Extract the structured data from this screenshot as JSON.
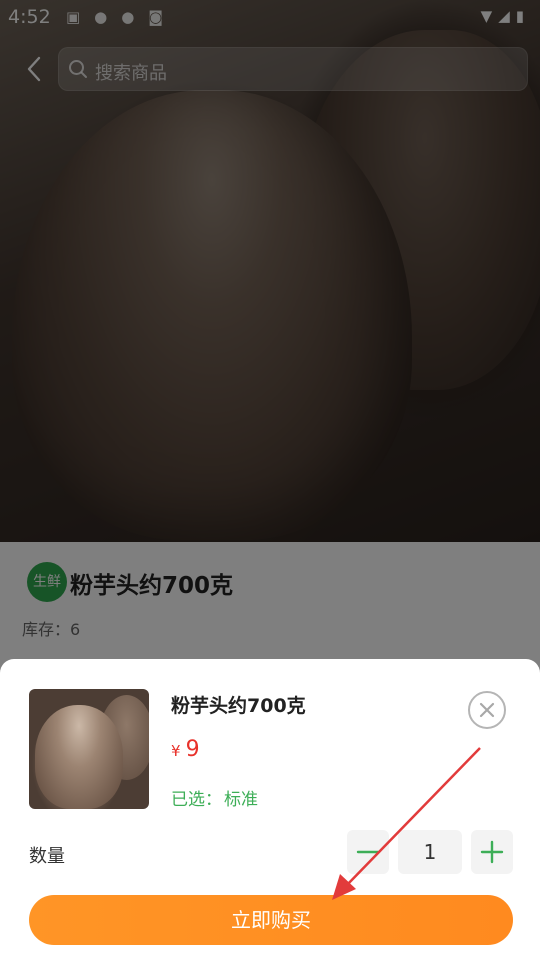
{
  "status_bar": {
    "time": "4:52"
  },
  "search": {
    "placeholder": "搜索商品"
  },
  "product_page": {
    "tag": "生鲜",
    "title": "粉芋头约700克",
    "stock_label": "库存：",
    "stock_value": "6"
  },
  "purchase_sheet": {
    "product_name": "粉芋头约700克",
    "currency_symbol": "¥",
    "price": "9",
    "selected_label": "已选：",
    "selected_value": "标准",
    "quantity_label": "数量",
    "quantity_value": "1",
    "buy_now_label": "立即购买"
  },
  "colors": {
    "buy_button": "#ff8f22",
    "price": "#e8312a",
    "accent_green": "#3dae57"
  }
}
